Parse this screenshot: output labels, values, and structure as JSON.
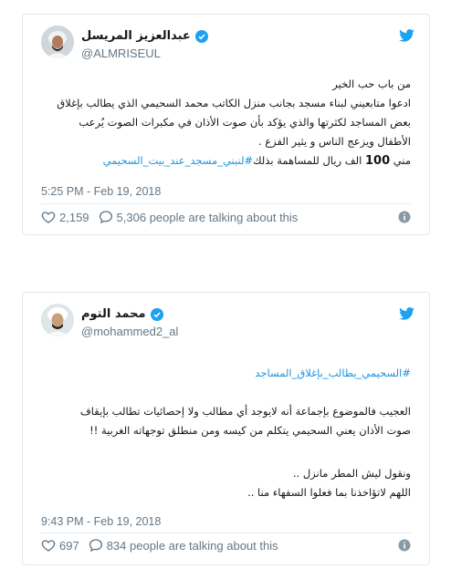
{
  "tweets": [
    {
      "author_name": "عبدالعزيز المريسل",
      "handle": "@ALMRISEUL",
      "lines": [
        "من باب حب الخير",
        "ادعوا متابعيني لبناء مسجد بجانب منزل الكاتب محمد السحيمي الذي يطالب بإغلاق",
        "بعض المساجد لكثرتها والذي يؤكد بأن صوت الأذان في مكبرات الصوت يُرعب",
        "الأطفال ويزعج الناس و يثير الفزع ."
      ],
      "last_line_prefix": "مني",
      "last_line_number": "100",
      "last_line_middle": "الف ريال للمساهمة بذلك",
      "last_line_hashtag": "#لنبني_مسجد_عند_بيت_السحيمي",
      "timestamp": "5:25 PM - Feb 19, 2018",
      "likes": "2,159",
      "talking": "5,306 people are talking about this"
    },
    {
      "author_name": "محمد التوم",
      "handle": "@mohammed2_al",
      "hashtag": "#السحيمي_يطالب_بإغلاق_المساجد",
      "lines": [
        "العجيب فالموضوع بإجماعة أنه لايوجد أي مطالب ولا إحصائيات تطالب بإيقاف",
        "صوت الأذان يعني السحيمي يتكلم من كيسه ومن منطلق توجهاته الغربية !!"
      ],
      "lines2": [
        "ونقول ليش المطر مانزل ..",
        "اللهم لاتؤاخذنا بما فعلوا السفهاء منا .."
      ],
      "timestamp": "9:43 PM - Feb 19, 2018",
      "likes": "697",
      "talking": "834 people are talking about this"
    }
  ],
  "colors": {
    "link": "#1b95e0",
    "brand": "#1da1f2",
    "meta": "#657786",
    "heart": "#657786"
  },
  "icons": {
    "bird": "twitter-bird-icon",
    "verified": "verified-badge-icon",
    "like": "heart-icon",
    "reply": "speech-bubble-icon",
    "info": "info-icon"
  }
}
